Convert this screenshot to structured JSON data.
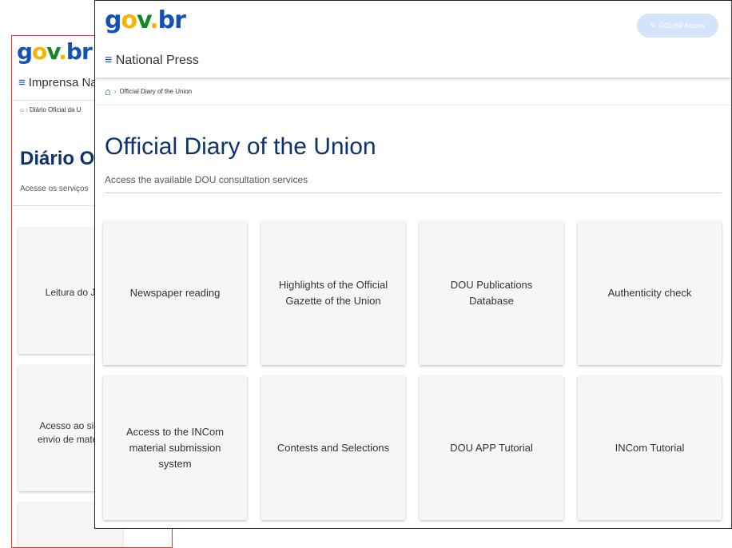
{
  "back_window": {
    "logo": {
      "g": "g",
      "o": "o",
      "v": "v",
      "dot": ".",
      "b": "b",
      "r": "r"
    },
    "menu_label": "Imprensa Na",
    "breadcrumb": "Diário Oficial da U",
    "title": "Diário Ofi",
    "subtitle": "Acesse os serviços",
    "cards": [
      "Leitura do J",
      "Acesso ao sist\nenvio de matéri",
      ""
    ]
  },
  "front_window": {
    "logo": {
      "g": "g",
      "o": "o",
      "v": "v",
      "dot": ".",
      "b": "b",
      "r": "r"
    },
    "access_button": "GOV.BR Access",
    "menu_label": "National Press",
    "breadcrumb": "Official Diary of the Union",
    "title": "Official Diary of the Union",
    "subtitle": "Access the available DOU consultation services",
    "cards": [
      "Newspaper reading",
      "Highlights of the Official Gazette of the Union",
      "DOU Publications Database",
      "Authenticity check",
      "Access to the INCom material submission system",
      "Contests and Selections",
      "DOU APP Tutorial",
      "INCom Tutorial"
    ]
  },
  "colors": {
    "brand_blue": "#1351b4",
    "title_blue": "#0c326f",
    "yellow": "#f5b400",
    "green": "#168821",
    "back_border": "#e53935"
  },
  "icons": [
    "menu-icon",
    "home-icon",
    "chevron-right-icon",
    "edit-icon"
  ]
}
